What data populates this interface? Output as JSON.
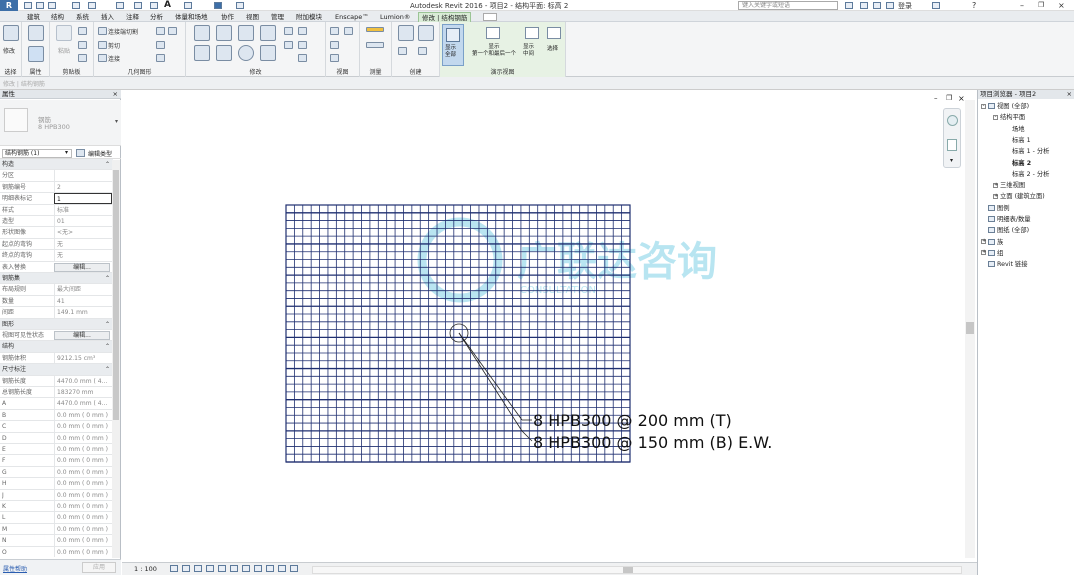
{
  "app": {
    "logo": "R",
    "title": "Autodesk Revit 2016 - ",
    "document": "项目2 - 结构平面: 标高 2",
    "search_placeholder": "键入关键字或短语",
    "login": "登录"
  },
  "menu": {
    "tabs": [
      "建筑",
      "结构",
      "系统",
      "插入",
      "注释",
      "分析",
      "体量和场地",
      "协作",
      "视图",
      "管理",
      "附加模块",
      "Enscape™",
      "Lumion®",
      "修改 | 结构钢筋"
    ],
    "active_tab": "修改 | 结构钢筋"
  },
  "ribbon": {
    "modify_label": "修改",
    "select_label": "选择",
    "properties_label": "属性",
    "clipboard_label": "剪贴板",
    "paste_label": "粘贴",
    "cut_join_label": "连接端切割",
    "cut_label": "剪切",
    "join_label": "连接",
    "geometry_label": "几何图形",
    "modify_group_label": "修改",
    "view_label": "视图",
    "measure_label": "测量",
    "create_label": "创建",
    "presentation_group_label": "演示视图",
    "show_all": "显示\n全部",
    "show_first_last": "显示\n第一个和最后一个",
    "show_middle": "显示\n中间",
    "select_btn": "选择"
  },
  "strip_text": "修改 | 结构钢筋",
  "properties": {
    "title": "属性",
    "close": "×",
    "type_name": "钢筋",
    "type_sub": "8 HPB300",
    "instance_selector": "结构钢筋 (1)",
    "edit_type": "编辑类型",
    "rows": [
      {
        "k": "构造",
        "v": "",
        "sec": true
      },
      {
        "k": "分区",
        "v": ""
      },
      {
        "k": "钢筋编号",
        "v": "2"
      },
      {
        "k": "明细表标记",
        "v": "1",
        "edit": true
      },
      {
        "k": "样式",
        "v": "标准"
      },
      {
        "k": "造型",
        "v": "01"
      },
      {
        "k": "形状图像",
        "v": "<无>"
      },
      {
        "k": "起点的弯钩",
        "v": "无"
      },
      {
        "k": "终点的弯钩",
        "v": "无"
      },
      {
        "k": "表入替换",
        "v": "编辑...",
        "btn": true
      },
      {
        "k": "钢筋集",
        "v": "",
        "sec": true
      },
      {
        "k": "布局规则",
        "v": "最大间距"
      },
      {
        "k": "数量",
        "v": "41"
      },
      {
        "k": "间距",
        "v": "149.1 mm"
      },
      {
        "k": "图形",
        "v": "",
        "sec": true
      },
      {
        "k": "视图可见性状态",
        "v": "编辑...",
        "btn": true
      },
      {
        "k": "结构",
        "v": "",
        "sec": true
      },
      {
        "k": "钢筋体积",
        "v": "9212.15 cm³"
      },
      {
        "k": "尺寸标注",
        "v": "",
        "sec": true
      },
      {
        "k": "钢筋长度",
        "v": "4470.0 mm ( 4..."
      },
      {
        "k": "总钢筋长度",
        "v": "183270 mm"
      },
      {
        "k": "A",
        "v": "4470.0 mm ( 4..."
      },
      {
        "k": "B",
        "v": "0.0 mm ( 0 mm )"
      },
      {
        "k": "C",
        "v": "0.0 mm ( 0 mm )"
      },
      {
        "k": "D",
        "v": "0.0 mm ( 0 mm )"
      },
      {
        "k": "E",
        "v": "0.0 mm ( 0 mm )"
      },
      {
        "k": "F",
        "v": "0.0 mm ( 0 mm )"
      },
      {
        "k": "G",
        "v": "0.0 mm ( 0 mm )"
      },
      {
        "k": "H",
        "v": "0.0 mm ( 0 mm )"
      },
      {
        "k": "J",
        "v": "0.0 mm ( 0 mm )"
      },
      {
        "k": "K",
        "v": "0.0 mm ( 0 mm )"
      },
      {
        "k": "L",
        "v": "0.0 mm ( 0 mm )"
      },
      {
        "k": "M",
        "v": "0.0 mm ( 0 mm )"
      },
      {
        "k": "N",
        "v": "0.0 mm ( 0 mm )"
      },
      {
        "k": "O",
        "v": "0.0 mm ( 0 mm )"
      }
    ],
    "help_link": "属性帮助",
    "apply": "应用"
  },
  "canvas": {
    "tag_top": "8 HPB300 @ 200 mm (T)",
    "tag_bottom": "8 HPB300 @ 150 mm (B) E.W.",
    "watermark_cn": "广联达咨询",
    "watermark_en": "CONSULTATION"
  },
  "statusbar": {
    "scale": "1 : 100"
  },
  "browser": {
    "title": "项目浏览器 - 项目2",
    "nodes": [
      {
        "t": "视图 (全部)",
        "lvl": 0,
        "exp": "-",
        "icon": true
      },
      {
        "t": "结构平面",
        "lvl": 1,
        "exp": "-"
      },
      {
        "t": "场地",
        "lvl": 2
      },
      {
        "t": "标高 1",
        "lvl": 2
      },
      {
        "t": "标高 1 - 分析",
        "lvl": 2
      },
      {
        "t": "标高 2",
        "lvl": 2,
        "bold": true
      },
      {
        "t": "标高 2 - 分析",
        "lvl": 2
      },
      {
        "t": "三维视图",
        "lvl": 1,
        "exp": "+"
      },
      {
        "t": "立面 (建筑立面)",
        "lvl": 1,
        "exp": "+"
      },
      {
        "t": "图例",
        "lvl": 0,
        "icon": true
      },
      {
        "t": "明细表/数量",
        "lvl": 0,
        "icon": true
      },
      {
        "t": "图纸 (全部)",
        "lvl": 0,
        "icon": true
      },
      {
        "t": "族",
        "lvl": 0,
        "exp": "+",
        "icon": true
      },
      {
        "t": "组",
        "lvl": 0,
        "exp": "+",
        "icon": true
      },
      {
        "t": "Revit 链接",
        "lvl": 0,
        "icon": true
      }
    ]
  },
  "colors": {
    "rebar": "#1f2f70",
    "accent": "#3d6fa8",
    "context_tab": "#d9ecd6",
    "watermark": "#7fd0e6"
  }
}
